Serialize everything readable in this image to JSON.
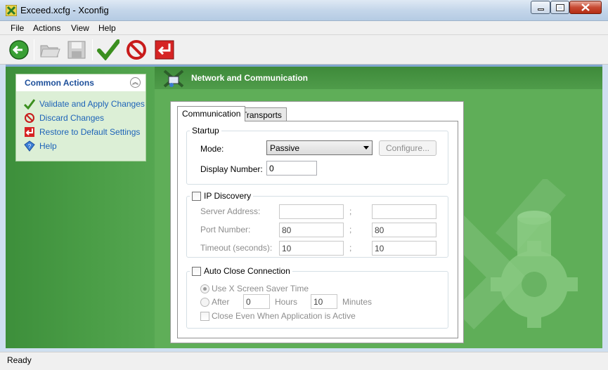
{
  "window": {
    "title": "Exceed.xcfg - Xconfig"
  },
  "menu": [
    "File",
    "Actions",
    "View",
    "Help"
  ],
  "toolbar": {
    "icons": [
      "back-arrow-icon",
      "open-folder-icon",
      "save-icon",
      "validate-check-icon",
      "discard-icon",
      "restore-icon"
    ]
  },
  "common_actions": {
    "title": "Common Actions",
    "links": [
      "Validate and Apply Changes",
      "Discard Changes",
      "Restore to Default Settings",
      "Help"
    ]
  },
  "main": {
    "title": "Network and Communication",
    "tabs": [
      "Communication",
      "Transports"
    ],
    "startup": {
      "legend": "Startup",
      "mode_label": "Mode:",
      "mode_value": "Passive",
      "configure_label": "Configure...",
      "display_number_label": "Display Number:",
      "display_number_value": "0"
    },
    "ip_discovery": {
      "legend": "IP Discovery",
      "server_address_label": "Server Address:",
      "port_number_label": "Port Number:",
      "timeout_label": "Timeout (seconds):",
      "separator": ";",
      "server_address_1": "",
      "server_address_2": "",
      "port_1": "80",
      "port_2": "80",
      "timeout_1": "10",
      "timeout_2": "10"
    },
    "auto_close": {
      "legend": "Auto Close Connection",
      "use_screensaver_label": "Use X Screen Saver Time",
      "after_label": "After",
      "hours_value": "0",
      "hours_label": "Hours",
      "minutes_value": "10",
      "minutes_label": "Minutes",
      "close_even_label": "Close Even When Application is Active"
    }
  },
  "status": {
    "text": "Ready"
  },
  "colors": {
    "accent_green": "#4b9e47",
    "link_blue": "#1d63b8"
  }
}
